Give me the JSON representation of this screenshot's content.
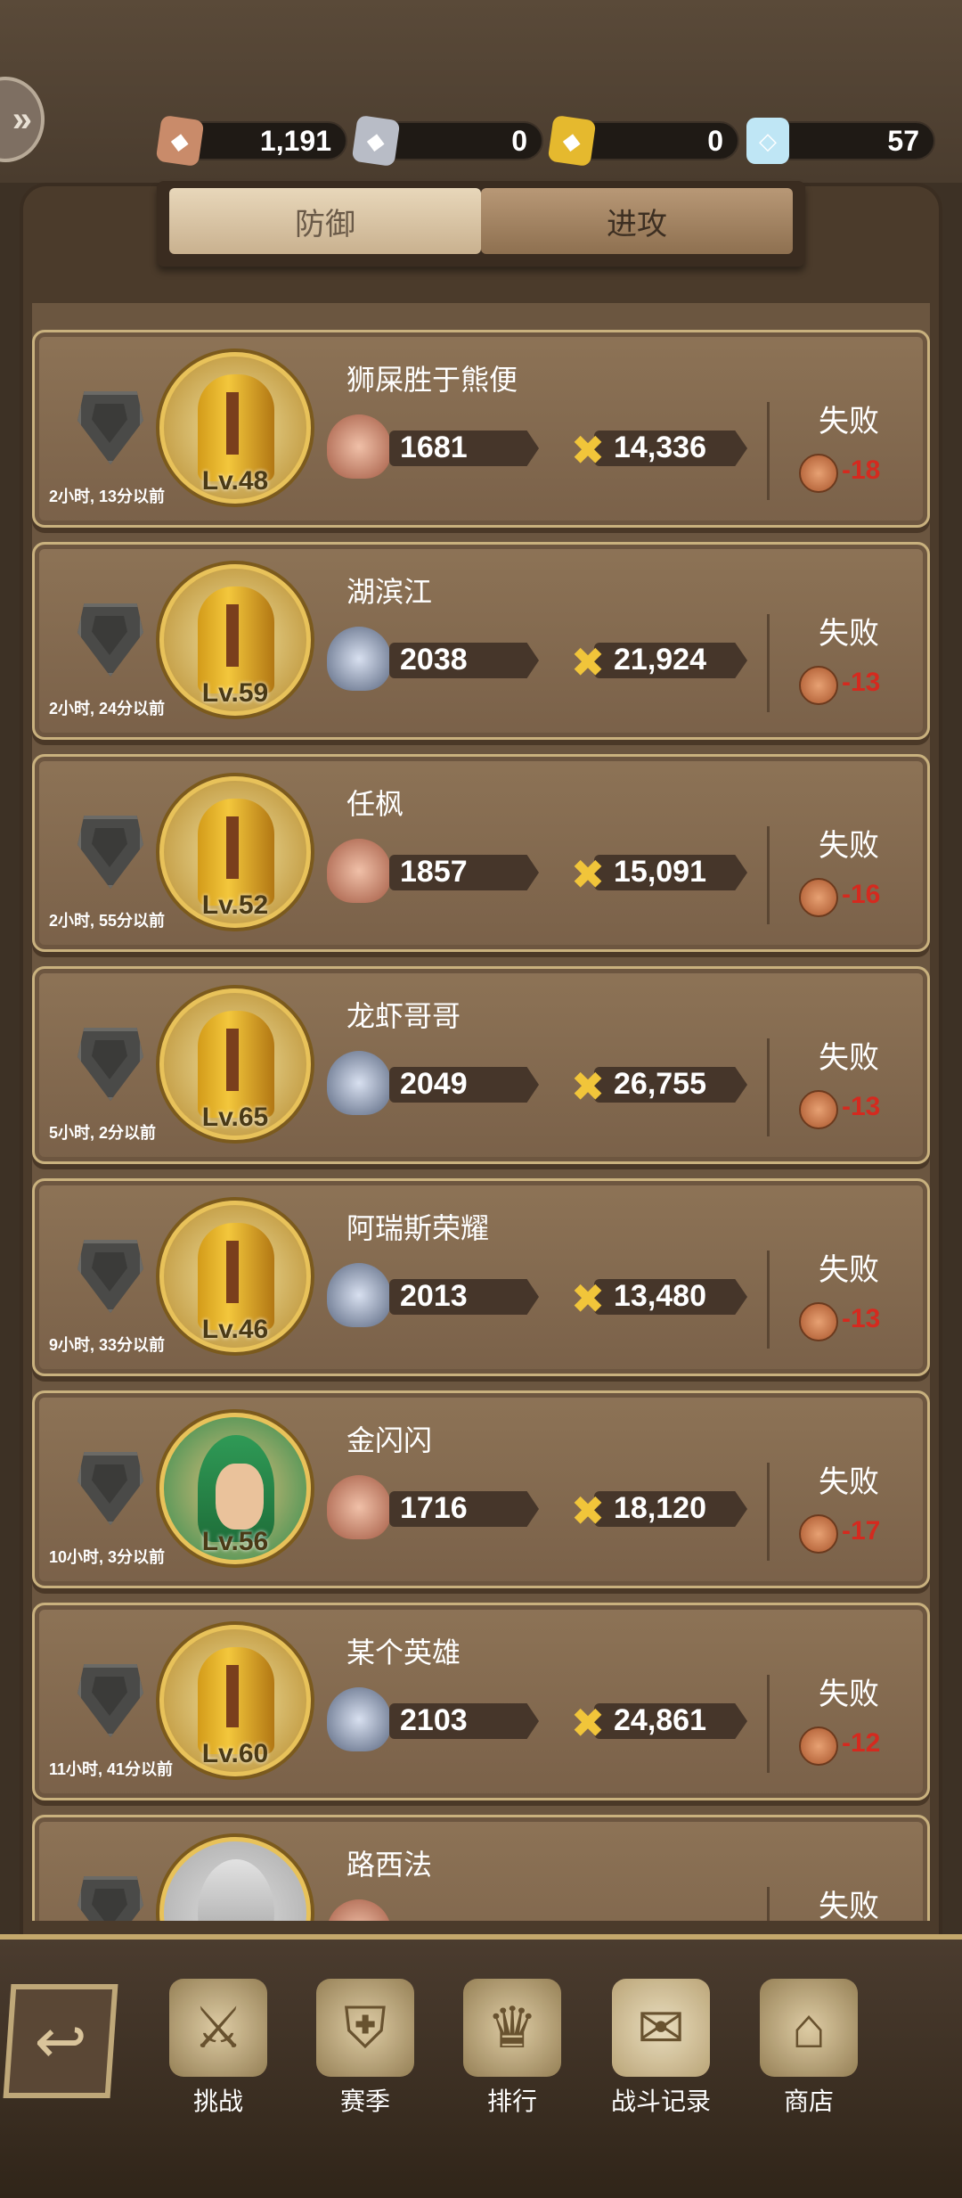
{
  "resources": {
    "copper": "1,191",
    "silver": "0",
    "gold": "0",
    "diamond": "57"
  },
  "tabs": {
    "defense": "防御",
    "attack": "进攻"
  },
  "records": [
    {
      "time": "2小时, 13分以前",
      "level": "Lv.48",
      "name": "狮屎胜于熊便",
      "rank": "1681",
      "power": "14,336",
      "result": "失败",
      "delta": "-18",
      "tier": "bronze"
    },
    {
      "time": "2小时, 24分以前",
      "level": "Lv.59",
      "name": "湖滨江",
      "rank": "2038",
      "power": "21,924",
      "result": "失败",
      "delta": "-13",
      "tier": "silver"
    },
    {
      "time": "2小时, 55分以前",
      "level": "Lv.52",
      "name": "任枫",
      "rank": "1857",
      "power": "15,091",
      "result": "失败",
      "delta": "-16",
      "tier": "bronze"
    },
    {
      "time": "5小时, 2分以前",
      "level": "Lv.65",
      "name": "龙虾哥哥",
      "rank": "2049",
      "power": "26,755",
      "result": "失败",
      "delta": "-13",
      "tier": "silver"
    },
    {
      "time": "9小时, 33分以前",
      "level": "Lv.46",
      "name": "阿瑞斯荣耀",
      "rank": "2013",
      "power": "13,480",
      "result": "失败",
      "delta": "-13",
      "tier": "silver"
    },
    {
      "time": "10小时, 3分以前",
      "level": "Lv.56",
      "name": "金闪闪",
      "rank": "1716",
      "power": "18,120",
      "result": "失败",
      "delta": "-17",
      "tier": "bronze"
    },
    {
      "time": "11小时, 41分以前",
      "level": "Lv.60",
      "name": "某个英雄",
      "rank": "2103",
      "power": "24,861",
      "result": "失败",
      "delta": "-12",
      "tier": "silver"
    },
    {
      "time": "",
      "level": "",
      "name": "路西法",
      "rank": "",
      "power": "",
      "result": "失败",
      "delta": "",
      "tier": "bronze"
    }
  ],
  "nav": {
    "challenge": "挑战",
    "season": "赛季",
    "ranking": "排行",
    "battle_log": "战斗记录",
    "shop": "商店"
  },
  "icons": {
    "back": "back-arrow-icon",
    "copper": "copper-coin-icon",
    "silver": "silver-coin-icon",
    "gold": "gold-coin-icon",
    "diamond": "diamond-icon",
    "power": "crossed-swords-icon"
  },
  "colors": {
    "loss_red": "#d42a1f",
    "gold_accent": "#f1c53a"
  }
}
